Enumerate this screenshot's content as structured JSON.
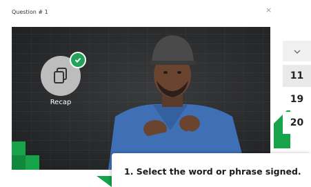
{
  "dialog": {
    "title": "Question # 1",
    "close_label": "×"
  },
  "recap": {
    "label": "Recap"
  },
  "answers": {
    "items": [
      "11",
      "19",
      "20"
    ]
  },
  "instruction": {
    "text": "1. Select the word or phrase signed."
  },
  "colors": {
    "accent_green": "#16a34a",
    "badge_green": "#22a35a"
  },
  "icons": [
    "close-icon",
    "copy-icon",
    "check-icon",
    "chevron-down-icon"
  ]
}
